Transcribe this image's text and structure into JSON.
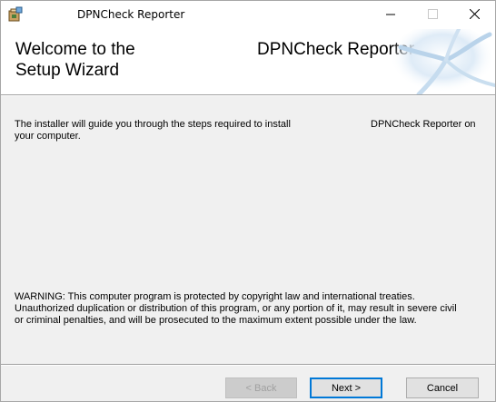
{
  "window": {
    "title": "DPNCheck Reporter",
    "app_icon": "installer-icon",
    "controls": {
      "minimize_icon": "minimize-icon",
      "maximize_icon": "maximize-icon",
      "close_icon": "close-icon"
    }
  },
  "banner": {
    "title_line1": "Welcome to the",
    "title_line2": "Setup Wizard",
    "product": "DPNCheck Reporter"
  },
  "body": {
    "intro_line1": "The installer will guide you through the steps required to install",
    "intro_product": "DPNCheck Reporter on",
    "intro_line2": "your computer.",
    "warning_line1": "WARNING: This computer program is protected by copyright law and international treaties.",
    "warning_line2": "Unauthorized duplication or distribution of this program, or any portion of it, may result in severe civil",
    "warning_line3": "or criminal penalties, and will be prosecuted to the maximum extent possible under the law."
  },
  "buttons": {
    "back": "< Back",
    "next": "Next >",
    "cancel": "Cancel"
  },
  "colors": {
    "focus_border": "#0078d7",
    "dialog_bg": "#f0f0f0"
  }
}
